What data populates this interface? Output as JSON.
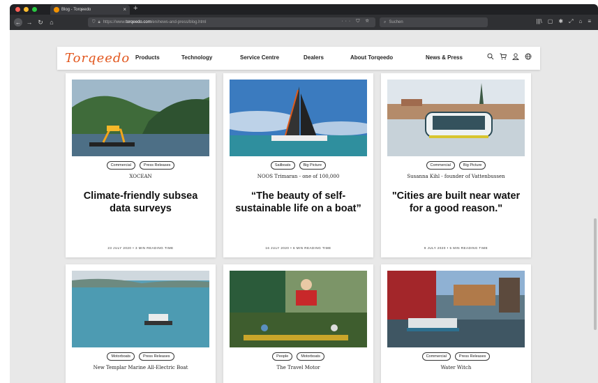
{
  "browser": {
    "tab_title": "Blog - Torqeedo",
    "url_prefix": "https://www.",
    "url_domain": "torqeedo.com",
    "url_path": "/en/news-and-press/blog.html",
    "search_placeholder": "Suchen",
    "url_icons": "··· ⛉ ☆"
  },
  "site": {
    "logo": "Torqeedo",
    "nav": [
      "Products",
      "Technology",
      "Service Centre",
      "Dealers",
      "About Torqeedo",
      "News & Press"
    ]
  },
  "cards": [
    {
      "tags": [
        "Commercial",
        "Press Releases"
      ],
      "subtitle": "XOCEAN",
      "title": "Climate-friendly subsea data surveys",
      "meta": "23 JULY 2020 • 3 MIN READING TIME"
    },
    {
      "tags": [
        "Sailboats",
        "Big Picture"
      ],
      "subtitle": "NOOS Trimaran - one of 100,000",
      "title": "“The beauty of self-sustainable life on a boat”",
      "meta": "16 JULY 2020 • 6 MIN READING TIME"
    },
    {
      "tags": [
        "Commercial",
        "Big Picture"
      ],
      "subtitle": "Susanna Kihl - founder of Vattenbussen",
      "title": "\"Cities are built near water for a good reason.\"",
      "meta": "9 JULY 2020 • 5 MIN READING TIME"
    },
    {
      "tags": [
        "Motorboats",
        "Press Releases"
      ],
      "subtitle": "New Templar Marine All-Electric Boat",
      "title": "",
      "meta": ""
    },
    {
      "tags": [
        "People",
        "Motorboats"
      ],
      "subtitle": "The Travel Motor",
      "title": "",
      "meta": ""
    },
    {
      "tags": [
        "Commercial",
        "Press Releases"
      ],
      "subtitle": "Water Witch",
      "title": "",
      "meta": ""
    }
  ]
}
